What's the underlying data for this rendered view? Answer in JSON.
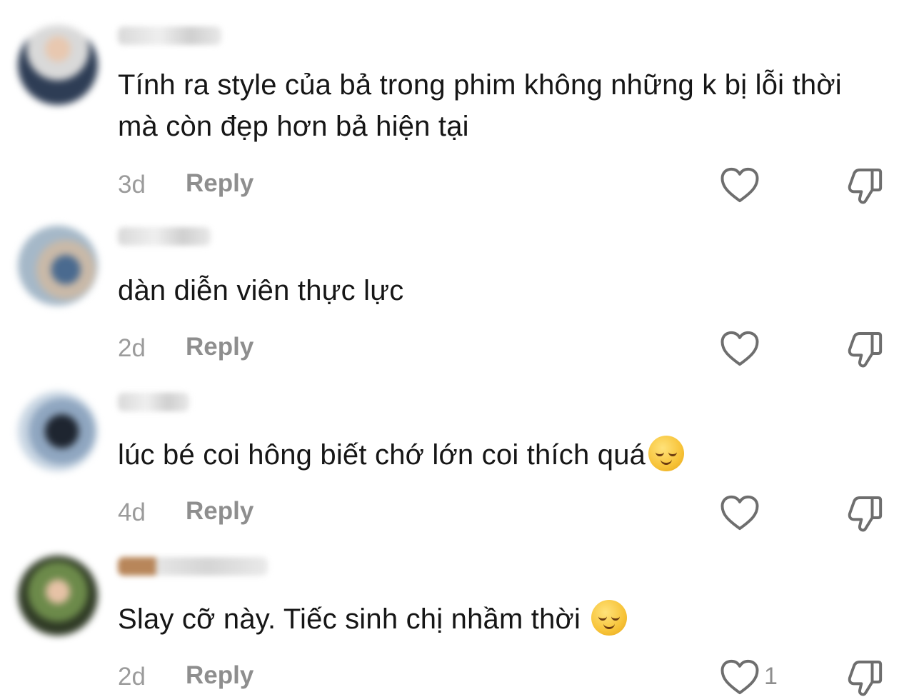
{
  "comments": [
    {
      "text": "Tính ra style của bả trong phim không những k bị lỗi thời mà còn đẹp hơn bả hiện tại",
      "time": "3d",
      "reply_label": "Reply",
      "like_count": "",
      "emoji": ""
    },
    {
      "text": "dàn diễn viên thực lực",
      "time": "2d",
      "reply_label": "Reply",
      "like_count": "",
      "emoji": ""
    },
    {
      "text": "lúc bé coi hông biết chớ lớn coi thích quá",
      "time": "4d",
      "reply_label": "Reply",
      "like_count": "",
      "emoji": "relieved-face"
    },
    {
      "text": "Slay cỡ này. Tiếc sinh chị nhầm thời ",
      "time": "2d",
      "reply_label": "Reply",
      "like_count": "1",
      "emoji": "relieved-face"
    }
  ],
  "icons": {
    "like": "heart-outline-icon",
    "dislike": "thumbs-down-outline-icon"
  },
  "colors": {
    "text": "#161616",
    "meta": "#9b9b9b",
    "icon": "#6e6e6e"
  }
}
